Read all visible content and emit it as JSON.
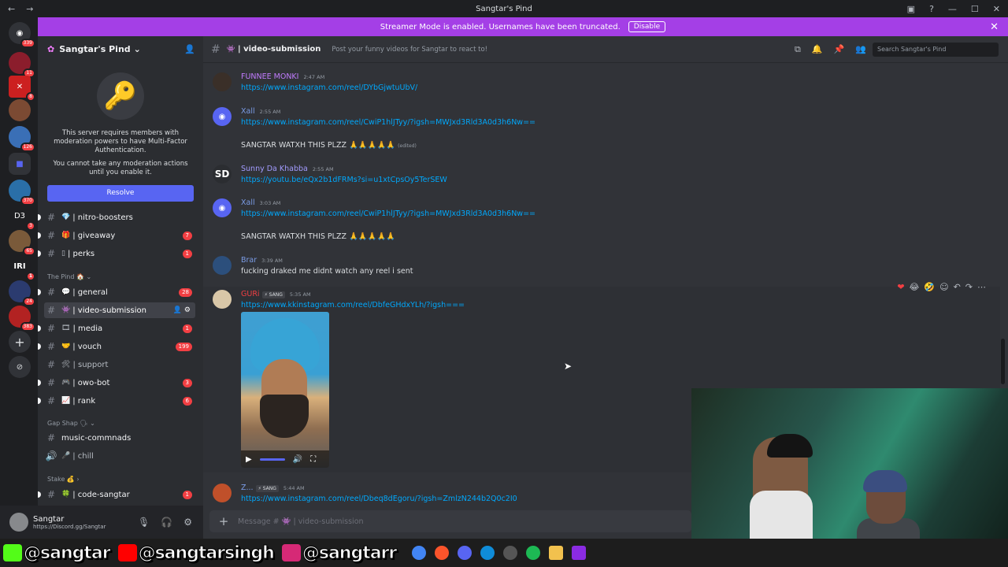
{
  "window": {
    "title": "Sangtar's Pind"
  },
  "banner": {
    "text": "Streamer Mode is enabled. Usernames have been truncated.",
    "button": "Disable"
  },
  "guild_badges": [
    "339",
    "11",
    "8",
    "126",
    "370",
    "3",
    "65",
    "1",
    "24",
    "383"
  ],
  "guild_labels": {
    "d3": "D3",
    "iri": "IRI"
  },
  "server": {
    "name": "Sangtar's Pind"
  },
  "mfa": {
    "line1": "This server requires members with moderation powers to have Multi-Factor Authentication.",
    "line2": "You cannot take any moderation actions until you enable it.",
    "button": "Resolve"
  },
  "channels": [
    {
      "name": "nitro-boosters",
      "emoji": "💎",
      "count": ""
    },
    {
      "name": "giveaway",
      "emoji": "🎁",
      "count": "7"
    },
    {
      "name": "perks",
      "emoji": "▯",
      "count": "1"
    },
    {
      "name": "general",
      "emoji": "💬",
      "count": "28"
    },
    {
      "name": "video-submission",
      "emoji": "👾",
      "count": ""
    },
    {
      "name": "media",
      "emoji": "🎞",
      "count": "1"
    },
    {
      "name": "vouch",
      "emoji": "🤝",
      "count": "199"
    },
    {
      "name": "support",
      "emoji": "🛠",
      "count": ""
    },
    {
      "name": "owo-bot",
      "emoji": "🎮",
      "count": "3"
    },
    {
      "name": "rank",
      "emoji": "📈",
      "count": "6"
    },
    {
      "name": "music-commnads",
      "emoji": "",
      "count": ""
    },
    {
      "name": "chill",
      "emoji": "🎤",
      "count": ""
    },
    {
      "name": "code-sangtar",
      "emoji": "🍀",
      "count": "1"
    }
  ],
  "categories": {
    "pind": "The Pind 🏠",
    "gapshap": "Gap Shap 🗣",
    "stake": "Stake 💰"
  },
  "user": {
    "name": "Sangtar",
    "sub": "https://Discord.gg/Sangtar"
  },
  "header": {
    "channel": "| video-submission",
    "topic": "Post your funny videos for Sangtar to react to!",
    "search_placeholder": "Search Sangtar's Pind"
  },
  "messages": [
    {
      "author": "FUNNEE MONKI",
      "color": "#c27cff",
      "time": "2:47 AM",
      "text": "https://www.instagram.com/reel/DYbGjwtuUbV/"
    },
    {
      "author": "Xall",
      "color": "#7b9ce6",
      "time": "2:55 AM",
      "text": "https://www.instagram.com/reel/CwiP1hlJTyy/?igsh=MWJxd3Rld3A0d3h6Nw==",
      "text2": "SANGTAR WATXH THIS PLZZ 🙏🙏🙏🙏🙏",
      "edited": "(edited)"
    },
    {
      "author": "Sunny Da Khabba",
      "color": "#a29bfe",
      "time": "2:55 AM",
      "text": "https://youtu.be/eQx2b1dFRMs?si=u1xtCpsOy5TerSEW"
    },
    {
      "author": "Xall",
      "color": "#7b9ce6",
      "time": "3:03 AM",
      "text": "https://www.instagram.com/reel/CwiP1hlJTyy/?igsh=MWJxd3Rld3A0d3h6Nw==",
      "text2": "SANGTAR WATXH THIS PLZZ 🙏🙏🙏🙏🙏"
    },
    {
      "author": "Brar",
      "color": "#7b9ce6",
      "time": "3:39 AM",
      "text": "fucking draked me didnt watch any reel i sent"
    },
    {
      "author": "GURi",
      "color": "#f23f43",
      "tag": "⚡ SANG",
      "time": "5:35 AM",
      "text": "https://www.kkinstagram.com/reel/DbfeGHdxYLh/?igsh==="
    },
    {
      "author": "Z...",
      "color": "#b5bac1",
      "tag": "⚡ SANG",
      "time": "5:44 AM",
      "text": "https://www.instagram.com/reel/Dbeq8dEgoru/?igsh=ZmlzN244b2Q0c2I0"
    }
  ],
  "composer": {
    "placeholder": "Message # 👾 | video-submission"
  },
  "taskbar": {
    "k": "@sangtar",
    "yt": "@sangtarsingh",
    "ig": "@sangtarr"
  },
  "colors": {
    "accent": "#5865f2",
    "banner": "#a43fe6",
    "link": "#00a8fc"
  }
}
